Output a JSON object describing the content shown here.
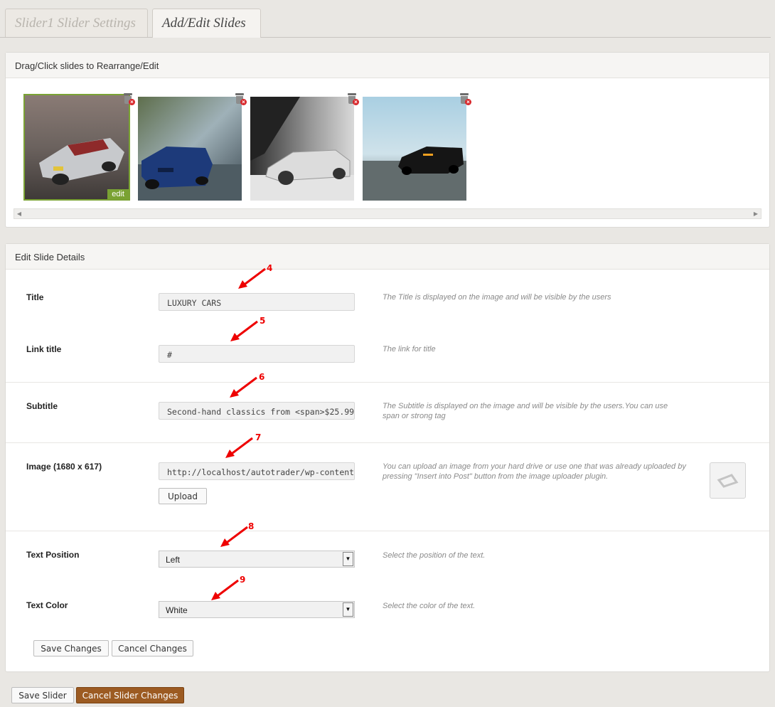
{
  "tabs": [
    {
      "label": "Slider1 Slider Settings",
      "active": false
    },
    {
      "label": "Add/Edit Slides",
      "active": true
    }
  ],
  "slides_panel": {
    "title": "Drag/Click slides to Rearrange/Edit",
    "edit_badge": "edit",
    "slides": [
      {
        "name": "silver-convertible",
        "selected": true
      },
      {
        "name": "blue-bmw-roadster",
        "selected": false
      },
      {
        "name": "silver-sedan",
        "selected": false
      },
      {
        "name": "black-lamborghini",
        "selected": false
      }
    ]
  },
  "details_panel": {
    "title": "Edit Slide Details",
    "fields": {
      "title": {
        "label": "Title",
        "value": "LUXURY CARS",
        "help": "The Title is displayed on the image and will be visible by the users"
      },
      "link_title": {
        "label": "Link title",
        "value": "#",
        "help": "The link for title"
      },
      "subtitle": {
        "label": "Subtitle",
        "value": "Second-hand classics from <span>$25.99(",
        "help": "The Subtitle is displayed on the image and will be visible by the users.You can use span or strong tag"
      },
      "image": {
        "label": "Image (1680 x 617)",
        "value": "http://localhost/autotrader/wp-content/upl",
        "help": "You can upload an image from your hard drive or use one that was already uploaded by pressing \"Insert into Post\" button from the image uploader plugin.",
        "upload_label": "Upload"
      },
      "text_position": {
        "label": "Text Position",
        "value": "Left",
        "help": "Select the position of the text."
      },
      "text_color": {
        "label": "Text Color",
        "value": "White",
        "help": "Select the color of the text."
      }
    },
    "save_changes": "Save Changes",
    "cancel_changes": "Cancel Changes"
  },
  "annotations": [
    "4",
    "5",
    "6",
    "7",
    "8",
    "9"
  ],
  "footer": {
    "save_slider": "Save Slider",
    "cancel_slider": "Cancel Slider Changes"
  },
  "colors": {
    "accent_green": "#7aa233",
    "primary_brown": "#9c5b22",
    "annotation_red": "#e00000"
  }
}
